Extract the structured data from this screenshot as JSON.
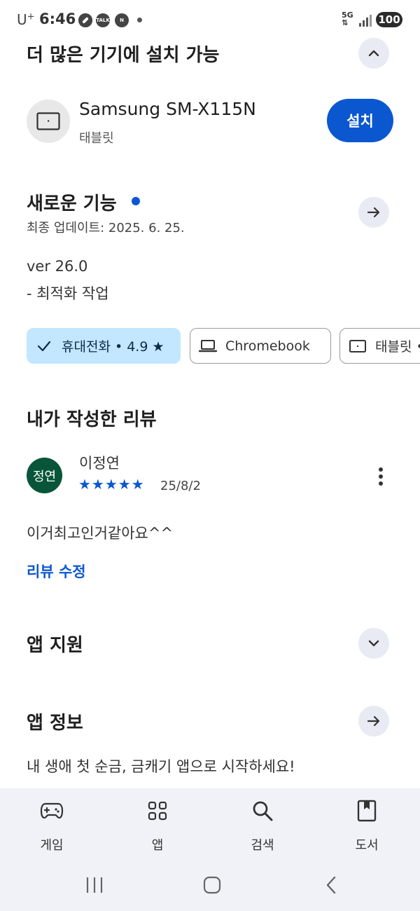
{
  "status_bar": {
    "carrier": "U",
    "carrier_sup": "+",
    "time": "6:46",
    "icons": [
      "messenger-icon",
      "talk-icon",
      "naver-icon"
    ],
    "network": "5G",
    "battery": "100"
  },
  "install_section": {
    "title": "더 많은 기기에 설치 가능",
    "device_name": "Samsung SM-X115N",
    "device_type": "태블릿",
    "install_label": "설치"
  },
  "whats_new": {
    "title": "새로운 기능",
    "updated": "최종 업데이트: 2025. 6. 25.",
    "version": "ver 26.0",
    "notes": "- 최적화 작업"
  },
  "chips": [
    {
      "label": "휴대전화 • 4.9 ★",
      "icon": "check-icon",
      "selected": true
    },
    {
      "label": "Chromebook",
      "icon": "laptop-icon",
      "selected": false
    },
    {
      "label": "태블릿 •",
      "icon": "tablet-icon",
      "selected": false
    }
  ],
  "my_review": {
    "title": "내가 작성한 리뷰",
    "avatar_text": "정연",
    "reviewer": "이정연",
    "stars": "★★★★★",
    "rating": 5,
    "date": "25/8/2",
    "text": "이거최고인거같아요^^",
    "edit_label": "리뷰 수정"
  },
  "app_support": {
    "title": "앱 지원"
  },
  "app_info": {
    "title": "앱 정보",
    "promo": "내 생애 첫 순금, 금캐기 앱으로 시작하세요!"
  },
  "bottom_nav": [
    {
      "label": "게임",
      "icon": "gamepad-icon"
    },
    {
      "label": "앱",
      "icon": "apps-grid-icon"
    },
    {
      "label": "검색",
      "icon": "search-icon"
    },
    {
      "label": "도서",
      "icon": "book-icon"
    }
  ],
  "colors": {
    "accent": "#0b57d0",
    "chip_selected_bg": "#c2e7ff",
    "avatar_bg": "#08553a",
    "round_button_bg": "#e8ebf3",
    "nav_bg": "#f0f2f8"
  }
}
